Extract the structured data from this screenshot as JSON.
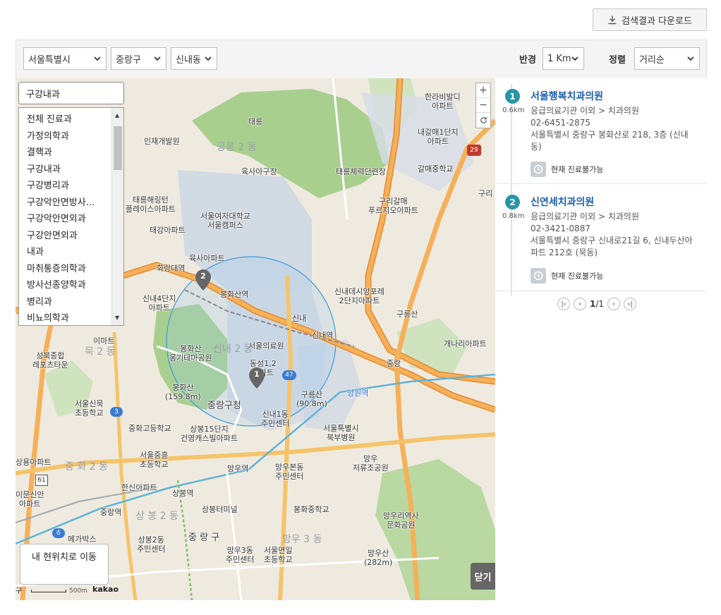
{
  "download_button": {
    "label": "검색결과 다운로드",
    "icon": "download-icon"
  },
  "filters": {
    "city": "서울특별시",
    "district": "중랑구",
    "dong": "신내동",
    "radius_label": "반경",
    "radius_value": "1 Km",
    "sort_label": "정렬",
    "sort_value": "거리순"
  },
  "dept": {
    "selected": "구강내과",
    "options": [
      "전체 진료과",
      "가정의학과",
      "결핵과",
      "구강내과",
      "구강병리과",
      "구강악안면방사...",
      "구강악안면외과",
      "구강안면외과",
      "내과",
      "마취통증의학과",
      "방사선종양학과",
      "병리과",
      "비뇨의학과"
    ]
  },
  "map": {
    "labels": {
      "hanribit": "한라비발디\n아파트",
      "naegalmae": "내갈매1단지\n아파트",
      "galmae_school": "갈매중학교",
      "taereung": "태릉",
      "injae": "인재개발원",
      "gongneung2": "공릉 2 동",
      "yuksa_gu": "육사아구장",
      "taereung_range": "태릉체력단련장",
      "gurigalmae": "구리갈매\n푸르지오아파트",
      "guri": "구리",
      "taereung_palace": "태릉해링턴\n플레이스아파트",
      "swu": "서울여자대학교\n서울캠퍼스",
      "taegang": "태강아파트",
      "yuksa_apt": "육사아파트",
      "hwarangdae": "화랑대역",
      "bongwhasan_station": "봉화산역",
      "sinnae_riport": "신내데시앙포레\n2단지아파트",
      "gureungsan": "구릉산",
      "sinnae4": "신내4단지\n아파트",
      "sinnae_ic": "신내",
      "sinnae_station": "신내역",
      "gaenari": "개나리아파트",
      "bongwhasan_park": "봉화산\n옹기테마공원",
      "seoul_hospital": "서울의료원",
      "jungnang_ic": "중랑",
      "dongseong": "동성1,2\n아파트",
      "bongwhasan_peak": "봉화산\n(159.8m)",
      "gureungsan_peak": "구릉산\n(90.8m)",
      "yangwonyeok": "양원역",
      "jungnang_office": "중랑구청",
      "sinnae1": "신내1동\n주민센터",
      "seoul_north": "서울특별시\n북부병원",
      "sangbong15": "상봉15단지\n건영캐스빌아파트",
      "junghwa_high": "중화고등학교",
      "seoul_jungsang": "서울중흥\n초등학교",
      "mangu_station": "망우역",
      "mangubon": "망우본동\n주민센터",
      "mangu_park": "망우\n저류조공원",
      "hanshin": "한신아파트",
      "sangbong_station": "상봉역",
      "sangbong_terminal": "상봉터미널",
      "bonghwa_middle": "봉화중학교",
      "mangu_history": "망우리역사\n문화공원",
      "jungnang_station": "중랑역",
      "sangbong2": "상봉2동\n주민센터",
      "jungnang_gu": "중 랑 구",
      "mangu3": "망우3동\n주민센터",
      "seoul_myeonil": "서울면일\n초등학교",
      "mangu_peak": "망우산\n(282m)",
      "megabox": "메가박스",
      "seongbuk": "성북종합\n레포츠타운",
      "imart": "이마트",
      "seoul_sinmuk": "서울신묵\n초등학교",
      "sangyong": "상용아파트",
      "imunsin": "이문신안\n아파트",
      "muk2": "묵 2 동",
      "junghwa2": "중 화 2 동",
      "sangbong2_faint": "상 봉 2 동",
      "mangu3_faint": "망우 3 동",
      "gureung1": "신내 2 동",
      "park_29": "29",
      "r61": "61",
      "r6": "6",
      "r47": "47",
      "r3": "3"
    },
    "markers": [
      "1",
      "2"
    ],
    "locate_label": "내 현위치로 이동",
    "close_label": "닫기",
    "scale_distance": "500m",
    "scale_prefix": "구 ",
    "map_logo": "kakao"
  },
  "results": [
    {
      "rank": "1",
      "distance": "0.6km",
      "name": "서울행복치과의원",
      "category": "응급의료기관 이외 > 치과의원",
      "phone": "02-6451-2875",
      "address": "서울특별시 중랑구 봉화산로 218, 3층 (신내동)",
      "status": "현재 진료불가능"
    },
    {
      "rank": "2",
      "distance": "0.8km",
      "name": "신연세치과의원",
      "category": "응급의료기관 이외 > 치과의원",
      "phone": "02-3421-0887",
      "address": "서울특별시 중랑구 신내로21길 6, 신내두산아파트 212호 (묵동)",
      "status": "현재 진료불가능"
    }
  ],
  "pagination": {
    "current": "1",
    "total": "1"
  },
  "colors": {
    "accent": "#2796a6",
    "link": "#1a5fad",
    "road_major": "#f5a623",
    "road_ring": "#e8882b",
    "park": "#b6d69a",
    "radius_circle": "#3a9bd5"
  }
}
